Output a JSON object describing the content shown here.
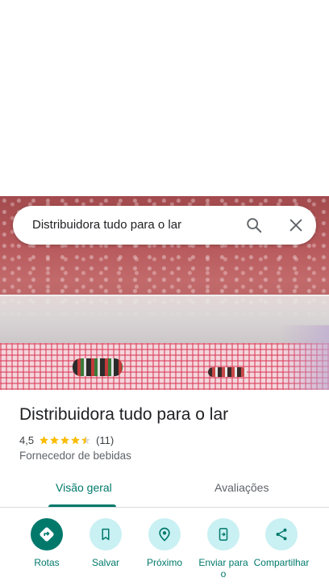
{
  "search": {
    "query": "Distribuidora tudo para o lar"
  },
  "place": {
    "name": "Distribuidora tudo para o lar",
    "rating": "4,5",
    "rating_value": 4.5,
    "review_count": "(11)",
    "category": "Fornecedor de bebidas"
  },
  "tabs": [
    {
      "label": "Visão geral",
      "selected": true
    },
    {
      "label": "Avaliações",
      "selected": false
    }
  ],
  "actions": [
    {
      "label": "Rotas",
      "icon": "directions-icon"
    },
    {
      "label": "Salvar",
      "icon": "bookmark-icon"
    },
    {
      "label": "Próximo",
      "icon": "nearby-icon"
    },
    {
      "label": "Enviar para o",
      "icon": "send-to-phone-icon"
    },
    {
      "label": "Compartilhar",
      "icon": "share-icon"
    }
  ],
  "colors": {
    "accent": "#00796b",
    "action_bg": "#c9f0f3",
    "star": "#fbbc04"
  }
}
